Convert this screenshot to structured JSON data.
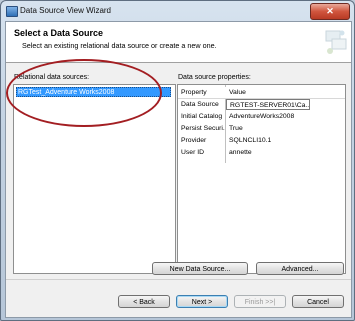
{
  "window": {
    "title": "Data Source View Wizard",
    "close_glyph": "✕"
  },
  "header": {
    "title": "Select a Data Source",
    "subtitle": "Select an existing relational data source or create a new one."
  },
  "left": {
    "label": "Relational data sources:",
    "items": [
      "RGTest_Adventure Works2008"
    ]
  },
  "right": {
    "label": "Data source properties:",
    "columns": [
      "Property",
      "Value"
    ],
    "rows": [
      [
        "Data Source",
        "RGTEST-SERVER01\\Ca..."
      ],
      [
        "Initial Catalog",
        "AdventureWorks2008"
      ],
      [
        "Persist Securi...",
        "True"
      ],
      [
        "Provider",
        "SQLNCLI10.1"
      ],
      [
        "User ID",
        "annette"
      ]
    ]
  },
  "buttons": {
    "new_data_source": "New Data Source...",
    "advanced": "Advanced...",
    "back": "< Back",
    "next": "Next >",
    "finish": "Finish >>|",
    "cancel": "Cancel"
  }
}
